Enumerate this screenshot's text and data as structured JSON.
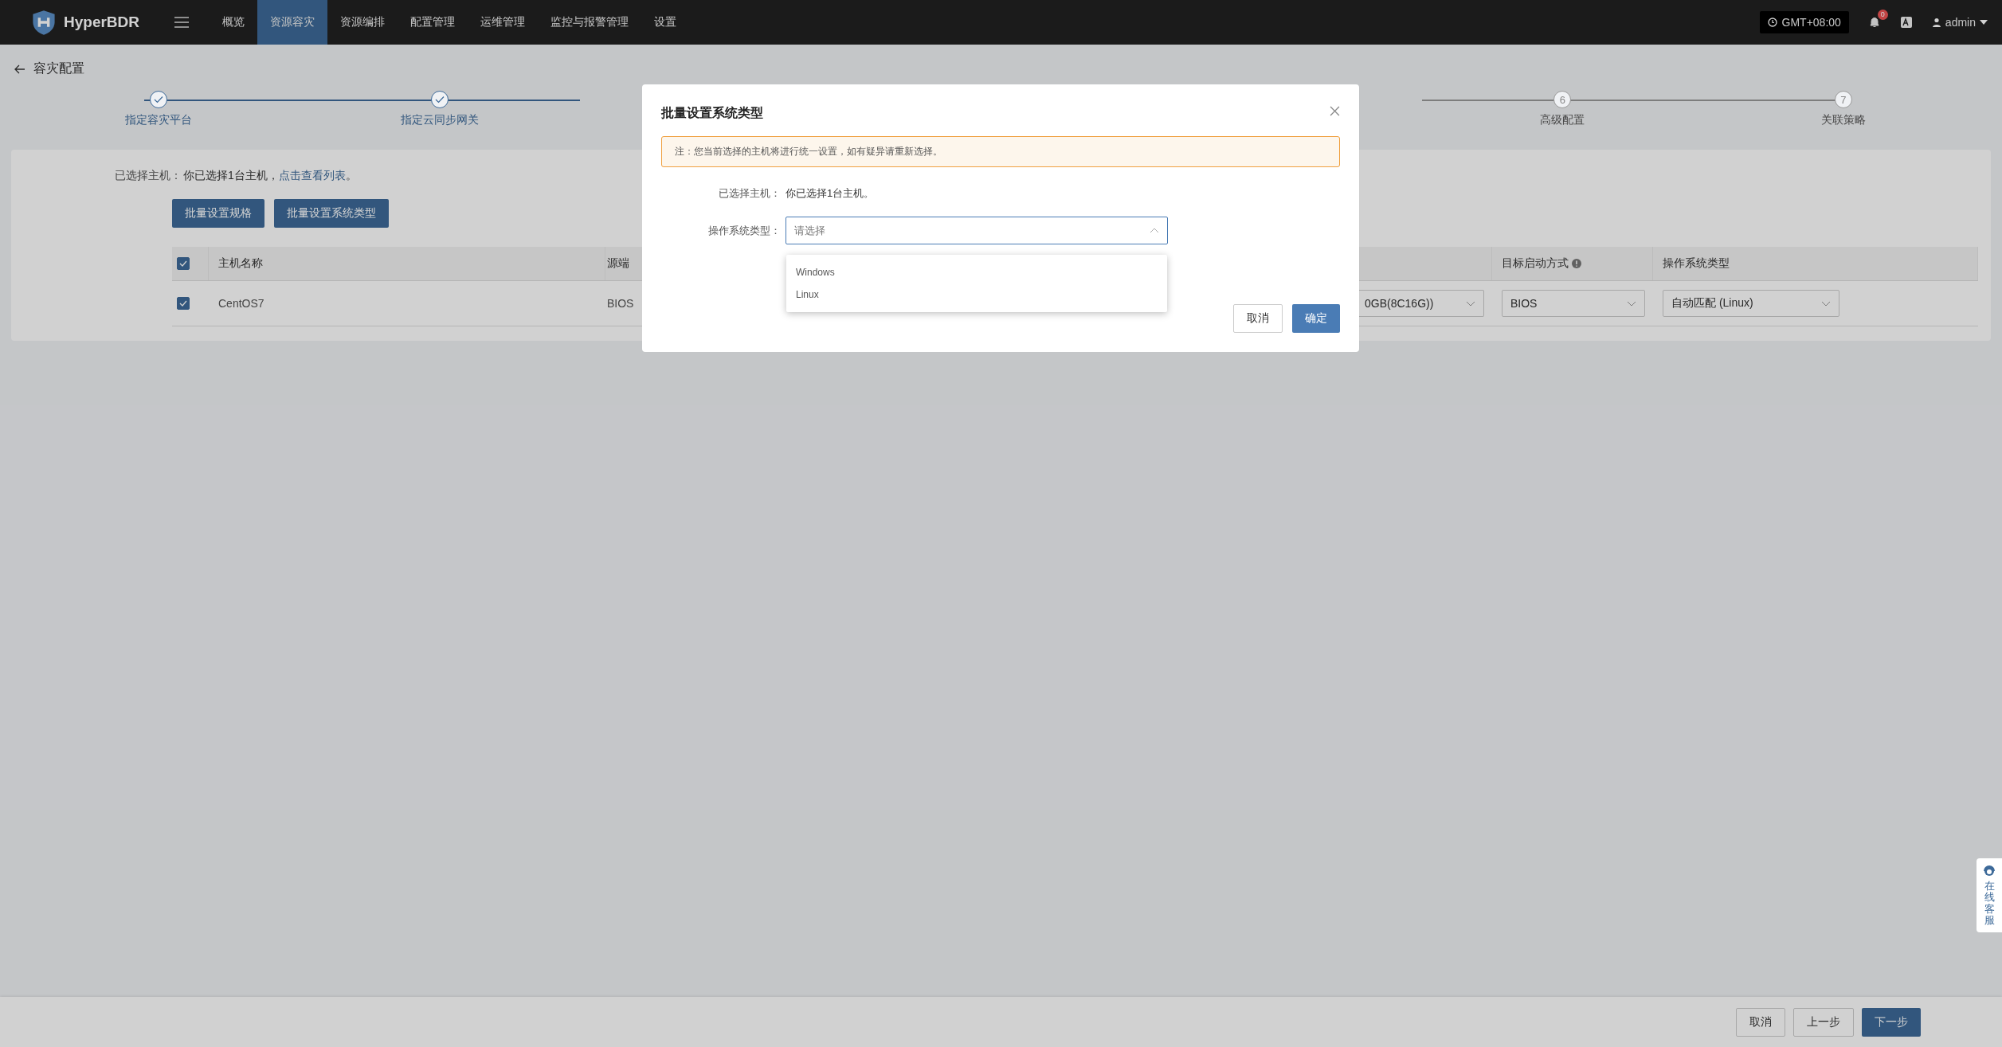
{
  "top_bar": {
    "brand": "HyperBDR",
    "nav": [
      {
        "label": "概览",
        "selected": false
      },
      {
        "label": "资源容灾",
        "selected": true
      },
      {
        "label": "资源编排",
        "selected": false
      },
      {
        "label": "配置管理",
        "selected": false
      },
      {
        "label": "运维管理",
        "selected": false
      },
      {
        "label": "监控与报警管理",
        "selected": false
      },
      {
        "label": "设置",
        "selected": false
      }
    ],
    "timezone": "GMT+08:00",
    "notification_count": "0",
    "user": "admin"
  },
  "page": {
    "title": "容灾配置"
  },
  "steps": [
    {
      "label": "指定容灾平台",
      "done": true
    },
    {
      "label": "指定云同步网关",
      "done": true
    },
    {
      "number": "6",
      "label": "高级配置",
      "done": false
    },
    {
      "number": "7",
      "label": "关联策略",
      "done": false
    }
  ],
  "selection": {
    "label": "已选择主机：",
    "text": "你已选择1台主机，",
    "link": "点击查看列表",
    "end": "。"
  },
  "batch_buttons": [
    "批量设置规格",
    "批量设置系统类型"
  ],
  "table": {
    "columns": [
      {
        "kind": "check",
        "checked": true
      },
      {
        "kind": "text",
        "label": "主机名称"
      },
      {
        "kind": "text",
        "label": "源端"
      },
      {
        "kind": "blank"
      },
      {
        "kind": "text",
        "label": "目标启动方式",
        "info": true
      },
      {
        "kind": "text",
        "label": "操作系统类型"
      }
    ],
    "rows": [
      {
        "cells": [
          {
            "kind": "check",
            "checked": true
          },
          {
            "kind": "text",
            "text": "CentOS7"
          },
          {
            "kind": "text",
            "text": "BIOS"
          },
          {
            "kind": "select",
            "value": "0GB(8C16G))"
          },
          {
            "kind": "select",
            "value": "BIOS"
          },
          {
            "kind": "select",
            "value": "自动匹配 (Linux)"
          }
        ]
      }
    ]
  },
  "footer_buttons": [
    {
      "label": "取消",
      "kind": "default"
    },
    {
      "label": "上一步",
      "kind": "default"
    },
    {
      "label": "下一步",
      "kind": "primary"
    }
  ],
  "support_widget": {
    "label": "在线客服"
  },
  "dialog": {
    "title": "批量设置系统类型",
    "notice": "注：您当前选择的主机将进行统一设置，如有疑异请重新选择。",
    "fields": [
      {
        "kind": "text",
        "label": "已选择主机：",
        "value": "你已选择1台主机。"
      },
      {
        "kind": "select",
        "label": "操作系统类型：",
        "placeholder": "请选择",
        "expanded": true,
        "options": [
          {
            "label": "Windows",
            "selected": false
          },
          {
            "label": "Linux",
            "selected": false
          }
        ]
      }
    ],
    "buttons": [
      {
        "label": "取消",
        "kind": "default"
      },
      {
        "label": "确定",
        "kind": "primary"
      }
    ]
  }
}
